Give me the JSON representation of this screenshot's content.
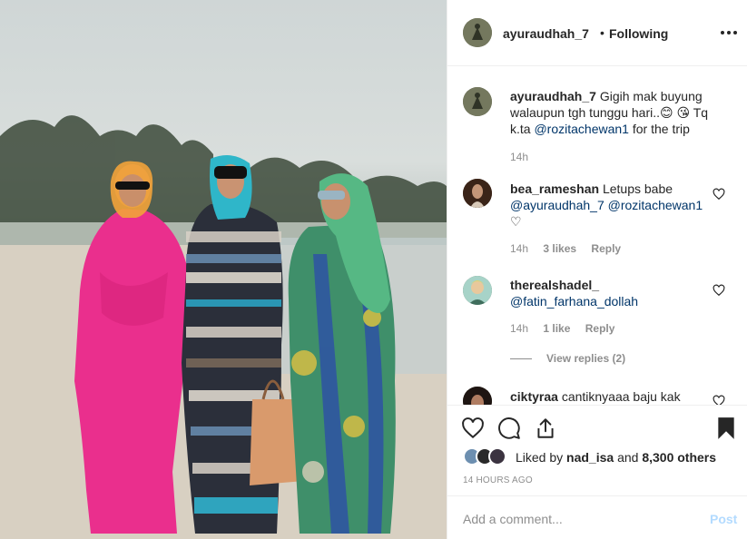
{
  "post": {
    "author": "ayuraudhah_7",
    "separator": "•",
    "follow_status": "Following"
  },
  "caption": {
    "author": "ayuraudhah_7",
    "text_before": "Gigih mak buyung walaupun tgh tunggu hari..",
    "emoji": "😊 😘",
    "text_mid": "Tq k.ta",
    "mention": "@rozitachewan1",
    "text_after": "for the trip",
    "time": "14h"
  },
  "comments": [
    {
      "user": "bea_rameshan",
      "text": "Letups babe",
      "mentions": [
        "@ayuraudhah_7",
        "@rozitachewan1"
      ],
      "emoji": "♡",
      "time": "14h",
      "likes": "3 likes",
      "reply_label": "Reply"
    },
    {
      "user": "therealshadel_",
      "text": "",
      "mentions": [
        "@fatin_farhana_dollah"
      ],
      "time": "14h",
      "likes": "1 like",
      "reply_label": "Reply",
      "view_replies": "View replies (2)"
    },
    {
      "user": "ciktyraa",
      "text": "cantiknyaaa baju kak"
    }
  ],
  "liked_by": {
    "prefix": "Liked by",
    "user": "nad_isa",
    "conjunction": "and",
    "others": "8,300 others"
  },
  "timestamp": "14 HOURS AGO",
  "add_comment": {
    "placeholder": "Add a comment...",
    "post_label": "Post"
  },
  "icons": {
    "more": "more-options-icon",
    "like": "heart-icon",
    "comment": "comment-icon",
    "share": "share-icon",
    "save": "bookmark-icon"
  },
  "colors": {
    "mention": "#003569",
    "meta": "#8e8e8e",
    "post_disabled": "#b3dbff"
  }
}
